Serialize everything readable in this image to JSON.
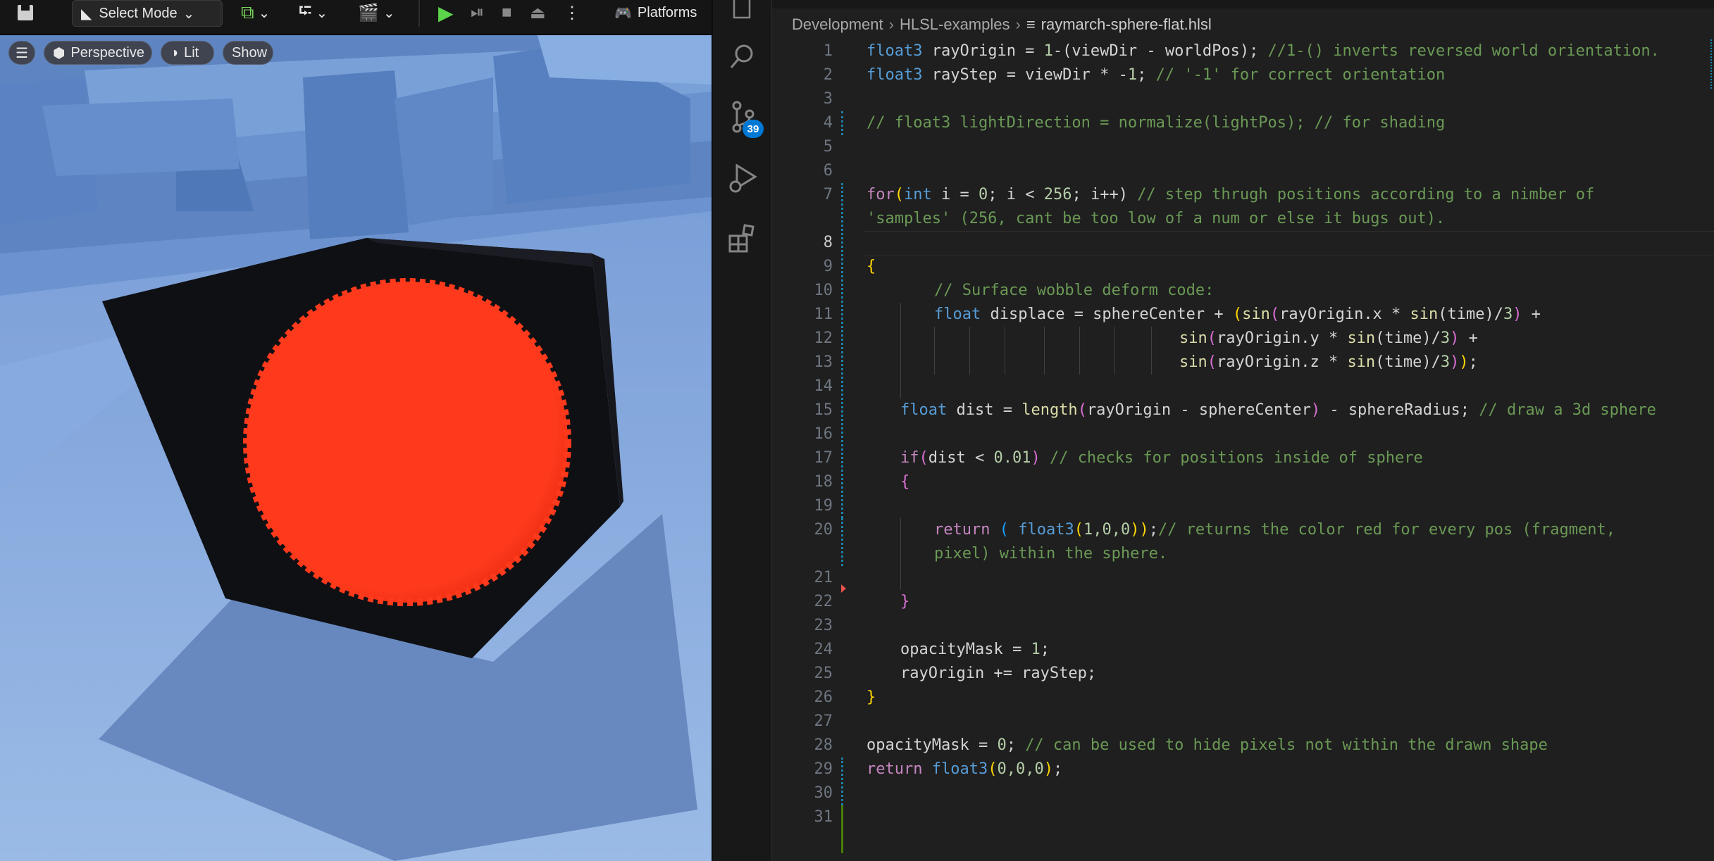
{
  "unreal": {
    "toolbar": {
      "select_mode": "Select Mode",
      "platforms": "Platforms"
    },
    "viewport": {
      "perspective": "Perspective",
      "lit": "Lit",
      "show": "Show"
    },
    "colors": {
      "sphere": "#ff3a1c",
      "cube": "#101014",
      "floor": "#8fb0e2",
      "sky": "#6c93cf"
    }
  },
  "vscode": {
    "breadcrumb": [
      "Development",
      "HLSL-examples",
      "raymarch-sphere-flat.hlsl"
    ],
    "scm_badge": "39",
    "active_line": "8",
    "lines": [
      {
        "n": "1"
      },
      {
        "n": "2"
      },
      {
        "n": "3"
      },
      {
        "n": "4"
      },
      {
        "n": "5"
      },
      {
        "n": "6"
      },
      {
        "n": "7"
      },
      {
        "n": "8"
      },
      {
        "n": "9"
      },
      {
        "n": "10"
      },
      {
        "n": "11"
      },
      {
        "n": "12"
      },
      {
        "n": "13"
      },
      {
        "n": "14"
      },
      {
        "n": "15"
      },
      {
        "n": "16"
      },
      {
        "n": "17"
      },
      {
        "n": "18"
      },
      {
        "n": "19"
      },
      {
        "n": "20"
      },
      {
        "n": "21"
      },
      {
        "n": "22"
      },
      {
        "n": "23"
      },
      {
        "n": "24"
      },
      {
        "n": "25"
      },
      {
        "n": "26"
      },
      {
        "n": "27"
      },
      {
        "n": "28"
      },
      {
        "n": "29"
      },
      {
        "n": "30"
      },
      {
        "n": "31"
      }
    ],
    "code": {
      "l1a": "float3",
      "l1b": " rayOrigin = ",
      "l1c": "1",
      "l1d": "-(viewDir - worldPos); ",
      "l1e": "//1-() inverts reversed world orientation.",
      "l2a": "float3",
      "l2b": " rayStep = viewDir * -",
      "l2c": "1",
      "l2d": "; ",
      "l2e": "// '-1' for correct orientation",
      "l4": "// float3 lightDirection = normalize(lightPos); // for shading",
      "l7a": "for",
      "l7b": "(",
      "l7c": "int",
      "l7d": " i = ",
      "l7e": "0",
      "l7f": "; i < ",
      "l7g": "256",
      "l7h": "; i++) ",
      "l7i": "// step thrugh positions according to a nimber of",
      "l7w": "'samples' (256, cant be too low of a num or else it bugs out).",
      "l9": "{",
      "l10": "// Surface wobble deform code:",
      "l11a": "float",
      "l11b": " displace = sphereCenter + ",
      "l11c": "(",
      "l11d": "sin",
      "l11e": "(",
      "l11f": "rayOrigin.x * ",
      "l11g": "sin",
      "l11h": "(time)/",
      "l11i": "3",
      "l11j": ")",
      "l11k": " +",
      "l12a": "sin",
      "l12b": "(",
      "l12c": "rayOrigin.y * ",
      "l12d": "sin",
      "l12e": "(time)/",
      "l12f": "3",
      "l12g": ")",
      "l12h": " +",
      "l13a": "sin",
      "l13b": "(",
      "l13c": "rayOrigin.z * ",
      "l13d": "sin",
      "l13e": "(time)/",
      "l13f": "3",
      "l13g": ")",
      "l13h": ")",
      "l13i": ";",
      "l15a": "float",
      "l15b": " dist = ",
      "l15c": "length",
      "l15d": "(",
      "l15e": "rayOrigin - sphereCenter",
      "l15f": ")",
      "l15g": " - sphereRadius; ",
      "l15h": "// draw a 3d sphere",
      "l17a": "if",
      "l17b": "(",
      "l17c": "dist < ",
      "l17d": "0.01",
      "l17e": ")",
      "l17f": " ",
      "l17g": "// checks for positions inside of sphere",
      "l18": "{",
      "l20a": "return",
      "l20b": " ( ",
      "l20c": "float3",
      "l20d": "(",
      "l20e": "1,0,0",
      "l20f": "))",
      "l20g": ";",
      "l20h": "// returns the color red for every pos (fragment,",
      "l20w": "pixel) within the sphere.",
      "l22": "}",
      "l24a": "opacityMask = ",
      "l24b": "1",
      "l24c": ";",
      "l25": "rayOrigin += rayStep;",
      "l26": "}",
      "l28a": "opacityMask = ",
      "l28b": "0",
      "l28c": "; ",
      "l28d": "// can be used to hide pixels not within the drawn shape",
      "l29a": "return",
      "l29b": " ",
      "l29c": "float3",
      "l29d": "(",
      "l29e": "0,0,0",
      "l29f": ")",
      "l29g": ";"
    }
  }
}
